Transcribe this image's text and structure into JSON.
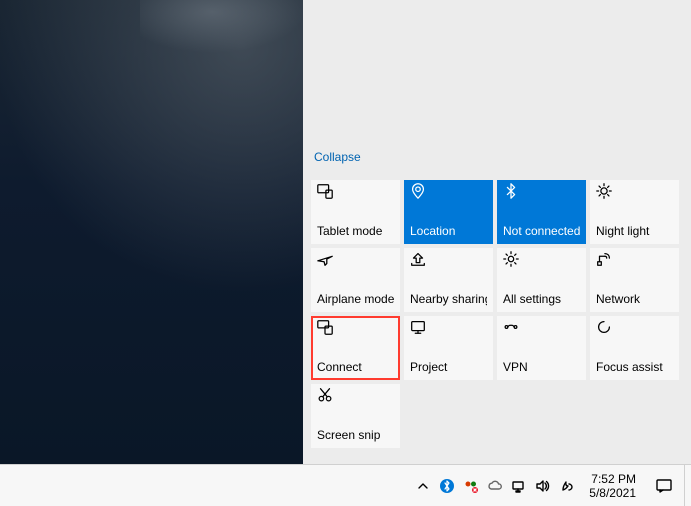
{
  "action_center": {
    "collapse_label": "Collapse",
    "tiles": [
      {
        "name": "tablet-mode",
        "icon": "tablet-icon",
        "label": "Tablet mode",
        "active": false,
        "highlight": false
      },
      {
        "name": "location",
        "icon": "location-icon",
        "label": "Location",
        "active": true,
        "highlight": false
      },
      {
        "name": "bluetooth",
        "icon": "bluetooth-icon",
        "label": "Not connected",
        "active": true,
        "highlight": false
      },
      {
        "name": "night-light",
        "icon": "night-light-icon",
        "label": "Night light",
        "active": false,
        "highlight": false
      },
      {
        "name": "airplane-mode",
        "icon": "airplane-icon",
        "label": "Airplane mode",
        "active": false,
        "highlight": false
      },
      {
        "name": "nearby-sharing",
        "icon": "share-icon",
        "label": "Nearby sharing",
        "active": false,
        "highlight": false
      },
      {
        "name": "all-settings",
        "icon": "settings-icon",
        "label": "All settings",
        "active": false,
        "highlight": false
      },
      {
        "name": "network",
        "icon": "network-icon",
        "label": "Network",
        "active": false,
        "highlight": false
      },
      {
        "name": "connect",
        "icon": "connect-icon",
        "label": "Connect",
        "active": false,
        "highlight": true
      },
      {
        "name": "project",
        "icon": "project-icon",
        "label": "Project",
        "active": false,
        "highlight": false
      },
      {
        "name": "vpn",
        "icon": "vpn-icon",
        "label": "VPN",
        "active": false,
        "highlight": false
      },
      {
        "name": "focus-assist",
        "icon": "focus-assist-icon",
        "label": "Focus assist",
        "active": false,
        "highlight": false
      },
      {
        "name": "screen-snip",
        "icon": "snip-icon",
        "label": "Screen snip",
        "active": false,
        "highlight": false
      }
    ]
  },
  "taskbar": {
    "time": "7:52 PM",
    "date": "5/8/2021"
  }
}
